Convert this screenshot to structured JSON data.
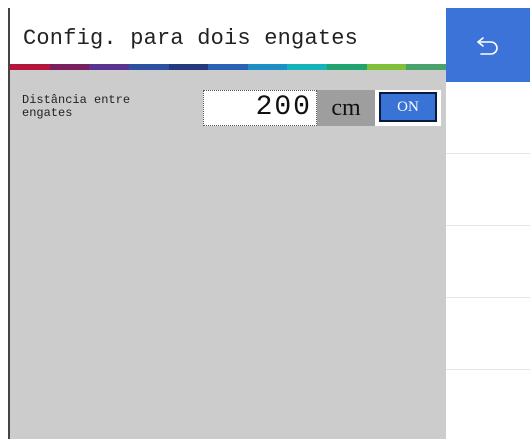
{
  "header": {
    "title": "Config. para dois engates"
  },
  "color_strip": [
    "#b5173a",
    "#7a1f5e",
    "#5a3391",
    "#2f4fa3",
    "#243a7e",
    "#2a63b5",
    "#1c8fc7",
    "#14b3b9",
    "#1fa46f",
    "#7fbf3a",
    "#4aa16b"
  ],
  "field": {
    "label": "Distância entre\nengates",
    "value": "200",
    "unit": "cm",
    "toggle_label": "ON"
  },
  "side": {
    "back_icon": "back-arrow-icon",
    "accent_color": "#3b73d9"
  }
}
